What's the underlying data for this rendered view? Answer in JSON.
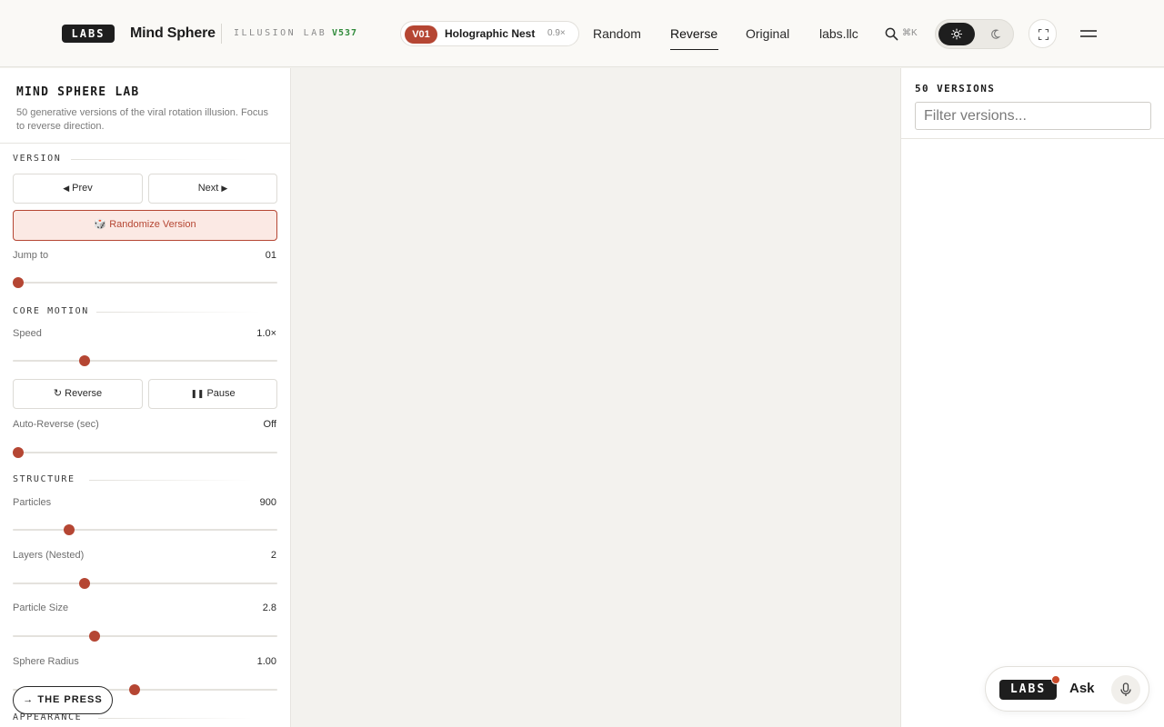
{
  "header": {
    "logo_text": "LABS",
    "app_title": "Mind Sphere",
    "lab_label": "ILLUSION LAB",
    "build": "V537",
    "version_pill": {
      "badge": "V01",
      "name": "Holographic Nest",
      "speed": "0.9×"
    },
    "nav": [
      "Random",
      "Reverse",
      "Original",
      "labs.llc"
    ],
    "active_nav": "Reverse",
    "search_shortcut": "⌘K",
    "theme": "light",
    "icons": [
      "search-icon",
      "sun-icon",
      "moon-icon",
      "fullscreen-icon",
      "menu-icon"
    ],
    "accent_color": "#b54633"
  },
  "left_panel": {
    "title": "MIND SPHERE LAB",
    "description": "50 generative versions of the viral rotation illusion. Focus to reverse direction.",
    "version_section": {
      "label": "VERSION",
      "prev_label": "Prev",
      "next_label": "Next",
      "randomize_label": "Randomize Version",
      "jump_label": "Jump to",
      "jump_value": "01",
      "jump_fraction": 0.0
    },
    "core_motion": {
      "label": "CORE MOTION",
      "speed_label": "Speed",
      "speed_value": "1.0×",
      "speed_fraction": 0.26,
      "reverse_label": "Reverse",
      "pause_label": "Pause",
      "auto_reverse_label": "Auto-Reverse (sec)",
      "auto_reverse_value": "Off",
      "auto_reverse_fraction": 0.0
    },
    "structure": {
      "label": "STRUCTURE",
      "particles_label": "Particles",
      "particles_value": "900",
      "particles_fraction": 0.2,
      "layers_label": "Layers (Nested)",
      "layers_value": "2",
      "layers_fraction": 0.26,
      "size_label": "Particle Size",
      "size_value": "2.8",
      "size_fraction": 0.3,
      "radius_label": "Sphere Radius",
      "radius_value": "1.00",
      "radius_fraction": 0.46
    },
    "appearance_label": "APPEARANCE",
    "press_label": "THE PRESS"
  },
  "right_panel": {
    "title": "50 VERSIONS",
    "filter_placeholder": "Filter versions..."
  },
  "ask_widget": {
    "logo_text": "LABS",
    "label": "Ask"
  }
}
